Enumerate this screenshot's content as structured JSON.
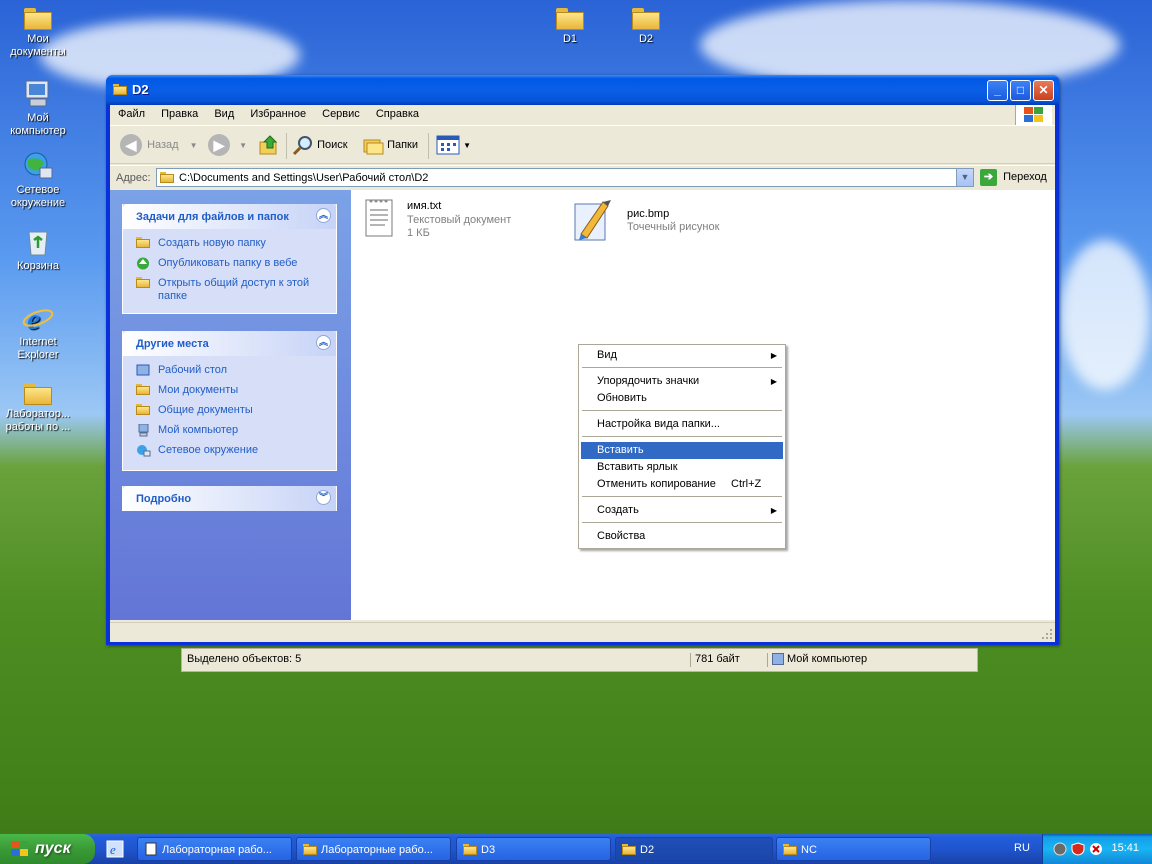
{
  "desktop": {
    "icons": [
      {
        "label": "Мои документы"
      },
      {
        "label": "Мой компьютер"
      },
      {
        "label": "Сетевое окружение"
      },
      {
        "label": "Корзина"
      },
      {
        "label": "Internet Explorer"
      },
      {
        "label": "Лаборатор... работы по ..."
      },
      {
        "label": "D1"
      },
      {
        "label": "D2"
      }
    ]
  },
  "window": {
    "title": "D2",
    "menu": [
      "Файл",
      "Правка",
      "Вид",
      "Избранное",
      "Сервис",
      "Справка"
    ],
    "toolbar": {
      "back": "Назад",
      "search": "Поиск",
      "folders": "Папки"
    },
    "address": {
      "label": "Адрес:",
      "value": "C:\\Documents and Settings\\User\\Рабочий стол\\D2",
      "go": "Переход"
    },
    "tasks_panel": {
      "title": "Задачи для файлов и папок",
      "items": [
        "Создать новую папку",
        "Опубликовать папку в вебе",
        "Открыть общий доступ к этой папке"
      ]
    },
    "places_panel": {
      "title": "Другие места",
      "items": [
        "Рабочий стол",
        "Мои документы",
        "Общие документы",
        "Мой компьютер",
        "Сетевое окружение"
      ]
    },
    "details_panel": {
      "title": "Подробно"
    },
    "files": [
      {
        "name": "имя.txt",
        "type": "Текстовый документ",
        "size": "1 КБ"
      },
      {
        "name": "рис.bmp",
        "type": "Точечный рисунок"
      }
    ]
  },
  "status": {
    "selected": "Выделено объектов: 5",
    "size": "781 байт",
    "location": "Мой компьютер"
  },
  "context_menu": {
    "items": [
      {
        "label": "Вид"
      },
      {
        "label": "Упорядочить значки"
      },
      {
        "label": "Обновить"
      },
      {
        "label": "Настройка вида папки..."
      },
      {
        "label": "Вставить"
      },
      {
        "label": "Вставить ярлык"
      },
      {
        "label": "Отменить копирование",
        "shortcut": "Ctrl+Z"
      },
      {
        "label": "Создать"
      },
      {
        "label": "Свойства"
      }
    ]
  },
  "taskbar": {
    "start": "пуск",
    "tasks": [
      "Лабораторная рабо...",
      "Лабораторные рабо...",
      "D3",
      "D2",
      "NC"
    ],
    "lang": "RU",
    "clock": "15:41"
  },
  "colors": {
    "accent": "#316ac5",
    "task_link": "#215dc6",
    "titlebar": "#0058e6"
  }
}
